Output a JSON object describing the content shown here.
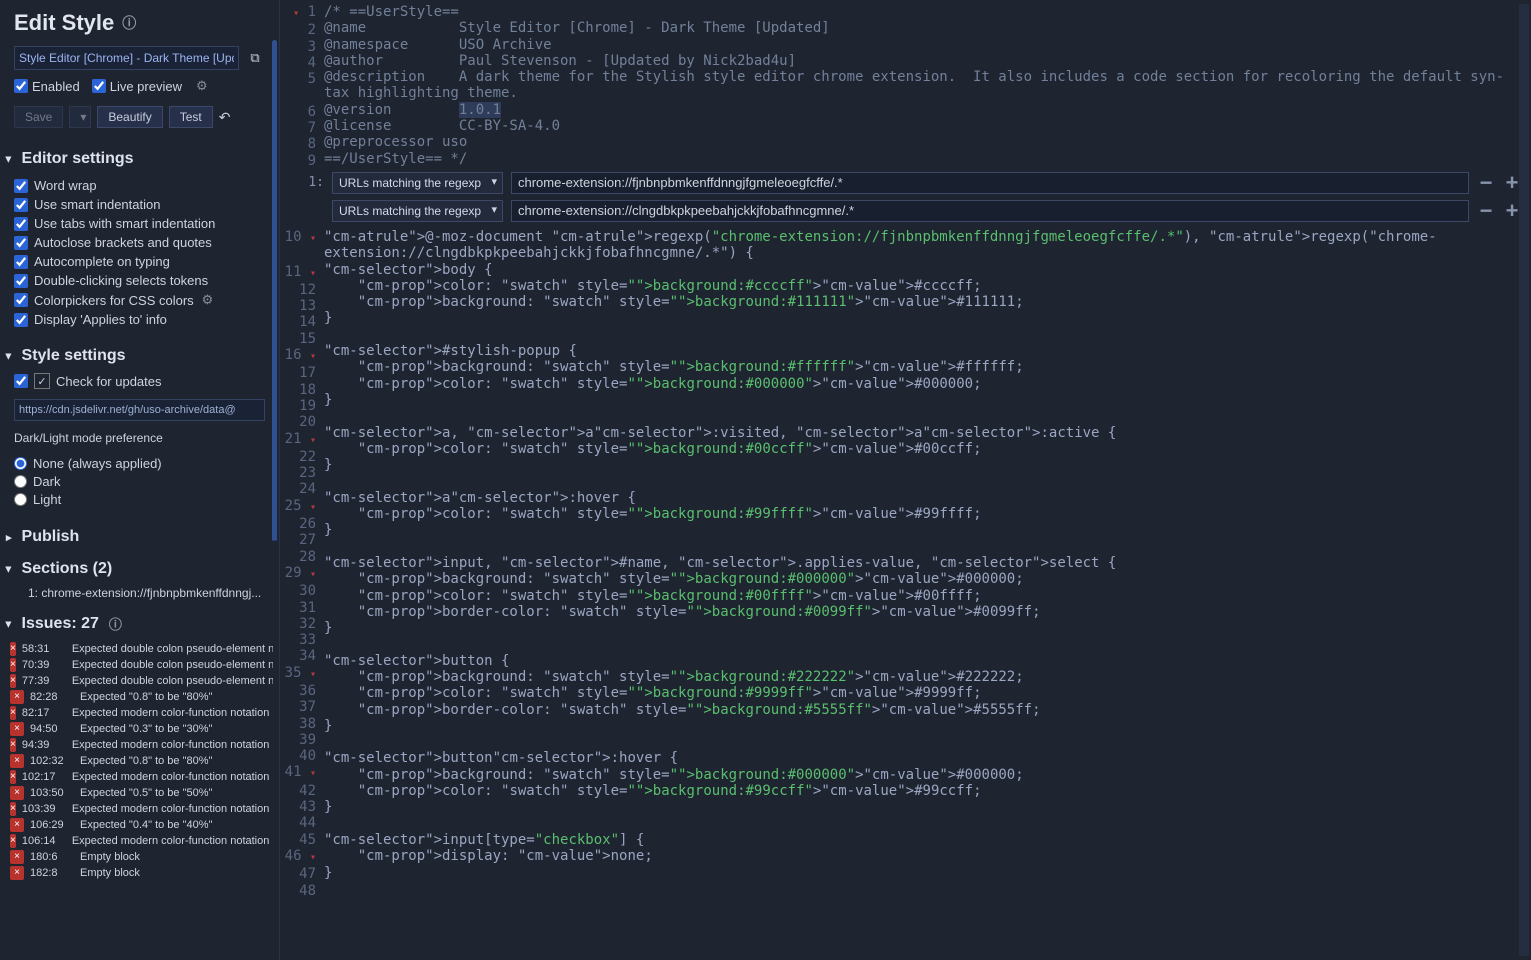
{
  "header": {
    "title": "Edit Style",
    "style_name": "Style Editor [Chrome] - Dark Theme [Upd"
  },
  "toggles": {
    "enabled": "Enabled",
    "live_preview": "Live preview"
  },
  "toolbar": {
    "save": "Save",
    "beautify": "Beautify",
    "test": "Test"
  },
  "editor_settings": {
    "heading": "Editor settings",
    "items": [
      "Word wrap",
      "Use smart indentation",
      "Use tabs with smart indentation",
      "Autoclose brackets and quotes",
      "Autocomplete on typing",
      "Double-clicking selects tokens",
      "Colorpickers for CSS colors",
      "Display 'Applies to' info"
    ]
  },
  "style_settings": {
    "heading": "Style settings",
    "check_updates": "Check for updates",
    "update_url": "https://cdn.jsdelivr.net/gh/uso-archive/data@",
    "mode_label": "Dark/Light mode preference",
    "modes": [
      "None (always applied)",
      "Dark",
      "Light"
    ]
  },
  "publish": {
    "heading": "Publish"
  },
  "sections": {
    "heading": "Sections (2)",
    "items": [
      {
        "idx": "1:",
        "label": "chrome-extension://fjnbnpbmkenffdnngj..."
      }
    ]
  },
  "issues": {
    "heading": "Issues: 27",
    "items": [
      {
        "pos": "58:31",
        "msg": "Expected double colon pseudo-element no"
      },
      {
        "pos": "70:39",
        "msg": "Expected double colon pseudo-element no"
      },
      {
        "pos": "77:39",
        "msg": "Expected double colon pseudo-element no"
      },
      {
        "pos": "82:28",
        "msg": "Expected \"0.8\" to be \"80%\""
      },
      {
        "pos": "82:17",
        "msg": "Expected modern color-function notation"
      },
      {
        "pos": "94:50",
        "msg": "Expected \"0.3\" to be \"30%\""
      },
      {
        "pos": "94:39",
        "msg": "Expected modern color-function notation"
      },
      {
        "pos": "102:32",
        "msg": "Expected \"0.8\" to be \"80%\""
      },
      {
        "pos": "102:17",
        "msg": "Expected modern color-function notation"
      },
      {
        "pos": "103:50",
        "msg": "Expected \"0.5\" to be \"50%\""
      },
      {
        "pos": "103:39",
        "msg": "Expected modern color-function notation"
      },
      {
        "pos": "106:29",
        "msg": "Expected \"0.4\" to be \"40%\""
      },
      {
        "pos": "106:14",
        "msg": "Expected modern color-function notation"
      },
      {
        "pos": "180:6",
        "msg": "Empty block"
      },
      {
        "pos": "182:8",
        "msg": "Empty block"
      }
    ]
  },
  "filters": {
    "label": "URLs matching the regexp",
    "rows": [
      {
        "idx": "1:",
        "value": "chrome-extension://fjnbnpbmkenffdnngjfgmeleoegfcffe/.*"
      },
      {
        "idx": "",
        "value": "chrome-extension://clngdbkpkpeebahjckkjfobafhncgmne/.*"
      }
    ]
  },
  "top_code": {
    "start": 1,
    "lines": [
      {
        "h": "/* ==UserStyle==",
        "cls": "cm-comment"
      },
      {
        "h": "@name           Style Editor [Chrome] - Dark Theme [Updated]",
        "cls": "cm-comment"
      },
      {
        "h": "@namespace      USO Archive",
        "cls": "cm-comment"
      },
      {
        "h": "@author         Paul Stevenson - [Updated by Nick2bad4u]",
        "cls": "cm-comment"
      },
      {
        "h": "@description    A dark theme for the Stylish style editor chrome extension.  It also includes a code section for recoloring the default syn-\ntax highlighting theme.",
        "cls": "cm-comment"
      },
      {
        "h": "@version        1.0.1",
        "cls": "cm-comment",
        "sel": "1.0.1"
      },
      {
        "h": "@license        CC-BY-SA-4.0",
        "cls": "cm-comment"
      },
      {
        "h": "@preprocessor uso",
        "cls": "cm-comment"
      },
      {
        "h": "==/UserStyle== */",
        "cls": "cm-comment"
      }
    ]
  },
  "main_code_start": 10,
  "main_code": [
    "@-moz-document regexp(\"chrome-extension://fjnbnpbmkenffdnngjfgmeleoegfcffe/.*\"), regexp(\"chrome-\nextension://clngdbkpkpeebahjckkjfobafhncgmne/.*\") {",
    "body {",
    "    color: ⬛#ccccff;",
    "    background: ⬛#111111;",
    "}",
    "",
    "#stylish-popup {",
    "    background: ⬛#ffffff;",
    "    color: ⬛#000000;",
    "}",
    "",
    "a, a:visited, a:active {",
    "    color: ⬛#00ccff;",
    "}",
    "",
    "a:hover {",
    "    color: ⬛#99ffff;",
    "}",
    "",
    "input, #name, .applies-value, select {",
    "    background: ⬛#000000;",
    "    color: ⬛#00ffff;",
    "    border-color: ⬛#0099ff;",
    "}",
    "",
    "button {",
    "    background: ⬛#222222;",
    "    color: ⬛#9999ff;",
    "    border-color: ⬛#5555ff;",
    "}",
    "",
    "button:hover {",
    "    background: ⬛#000000;",
    "    color: ⬛#99ccff;",
    "}",
    "",
    "input[type=\"checkbox\"] {",
    "    display: none;",
    "}"
  ]
}
